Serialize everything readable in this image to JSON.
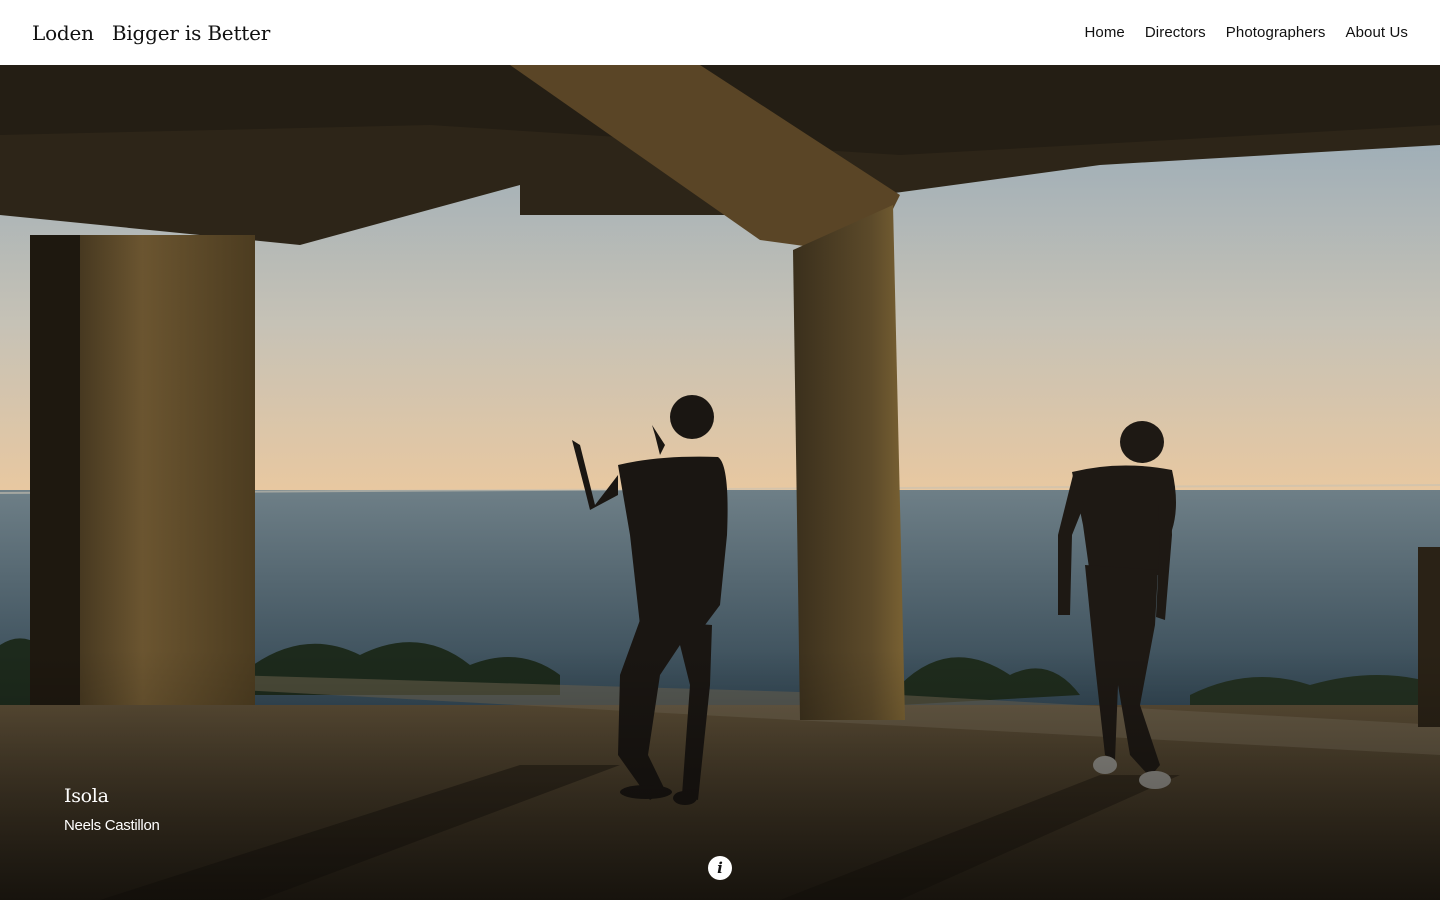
{
  "header": {
    "brand": "Loden",
    "tagline": "Bigger is Better",
    "nav": [
      {
        "label": "Home"
      },
      {
        "label": "Directors"
      },
      {
        "label": "Photographers"
      },
      {
        "label": "About Us"
      }
    ]
  },
  "hero": {
    "title": "Isola",
    "credit": "Neels Castillon",
    "info_icon": "i"
  },
  "colors": {
    "sky_top": "#9fb0bf",
    "sky_horizon": "#e8c9a2",
    "sea": "#3f5663",
    "concrete": "#4a3b22",
    "floor": "#3a3122",
    "silhouette": "#1a1612"
  }
}
